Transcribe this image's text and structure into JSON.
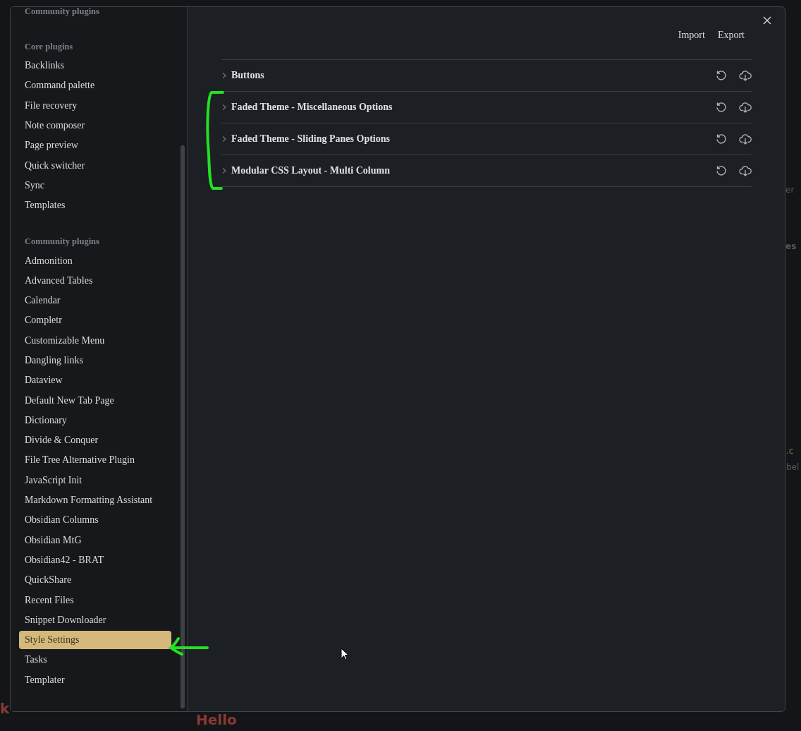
{
  "backdrop": {
    "texts": [
      {
        "text": "er",
        "kind": "plain"
      },
      {
        "text": "es",
        "kind": "bold"
      },
      {
        "text": ".c",
        "kind": "code"
      },
      {
        "text": "bel",
        "kind": "plain"
      },
      {
        "text": "Hello",
        "kind": "red"
      },
      {
        "text": "k",
        "kind": "red"
      }
    ]
  },
  "sidebar": {
    "sections": [
      {
        "heading": "Community plugins"
      },
      {
        "heading": "Core plugins",
        "items": [
          {
            "label": "Backlinks",
            "selected": false
          },
          {
            "label": "Command palette",
            "selected": false
          },
          {
            "label": "File recovery",
            "selected": false
          },
          {
            "label": "Note composer",
            "selected": false
          },
          {
            "label": "Page preview",
            "selected": false
          },
          {
            "label": "Quick switcher",
            "selected": false
          },
          {
            "label": "Sync",
            "selected": false
          },
          {
            "label": "Templates",
            "selected": false
          }
        ]
      },
      {
        "heading": "Community plugins",
        "items": [
          {
            "label": "Admonition",
            "selected": false
          },
          {
            "label": "Advanced Tables",
            "selected": false
          },
          {
            "label": "Calendar",
            "selected": false
          },
          {
            "label": "Completr",
            "selected": false
          },
          {
            "label": "Customizable Menu",
            "selected": false
          },
          {
            "label": "Dangling links",
            "selected": false
          },
          {
            "label": "Dataview",
            "selected": false
          },
          {
            "label": "Default New Tab Page",
            "selected": false
          },
          {
            "label": "Dictionary",
            "selected": false
          },
          {
            "label": "Divide & Conquer",
            "selected": false
          },
          {
            "label": "File Tree Alternative Plugin",
            "selected": false
          },
          {
            "label": "JavaScript Init",
            "selected": false
          },
          {
            "label": "Markdown Formatting Assistant",
            "selected": false
          },
          {
            "label": "Obsidian Columns",
            "selected": false
          },
          {
            "label": "Obsidian MtG",
            "selected": false
          },
          {
            "label": "Obsidian42 - BRAT",
            "selected": false
          },
          {
            "label": "QuickShare",
            "selected": false
          },
          {
            "label": "Recent Files",
            "selected": false
          },
          {
            "label": "Snippet Downloader",
            "selected": false
          },
          {
            "label": "Style Settings",
            "selected": true
          },
          {
            "label": "Tasks",
            "selected": false
          },
          {
            "label": "Templater",
            "selected": false
          }
        ]
      }
    ]
  },
  "header_actions": [
    "Import",
    "Export"
  ],
  "sections": [
    {
      "title": "Buttons",
      "expanded": false
    },
    {
      "title": "Faded Theme - Miscellaneous Options",
      "expanded": false
    },
    {
      "title": "Faded Theme - Sliding Panes Options",
      "expanded": false
    },
    {
      "title": "Modular CSS Layout - Multi Column",
      "expanded": false
    }
  ]
}
